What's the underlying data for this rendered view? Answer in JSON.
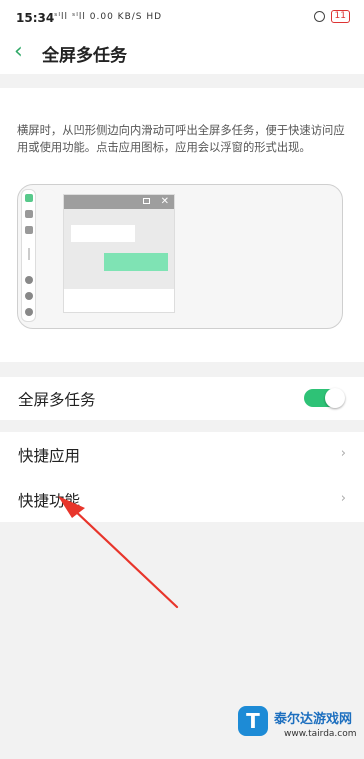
{
  "status_bar": {
    "time": "15:34",
    "signal_text": "ˢᴵll ˢᴵll 0.00 KB/S HD",
    "battery": "11"
  },
  "header": {
    "title": "全屏多任务"
  },
  "intro": {
    "description": "横屏时，从凹形侧边向内滑动可呼出全屏多任务，便于快速访问应用或使用功能。点击应用图标，应用会以浮窗的形式出现。"
  },
  "settings": {
    "fullscreen_multitask": {
      "label": "全屏多任务",
      "enabled": true
    },
    "items": [
      {
        "label": "快捷应用"
      },
      {
        "label": "快捷功能"
      }
    ]
  },
  "watermark": {
    "name": "泰尔达游戏网",
    "url": "www.tairda.com"
  },
  "colors": {
    "accent": "#2ec276",
    "arrow": "#e8352b"
  }
}
